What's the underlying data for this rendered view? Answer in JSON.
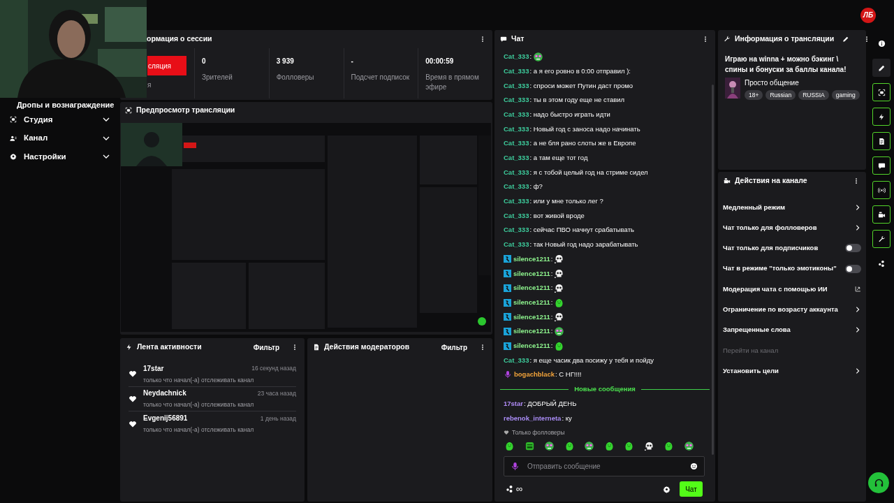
{
  "header": {
    "logo": "ЛБ"
  },
  "sidebar": {
    "partial_item": "Дропы и вознаграждение",
    "items": [
      {
        "label": "Студия",
        "expanded": false
      },
      {
        "label": "Канал",
        "expanded": false
      },
      {
        "label": "Настройки",
        "expanded": false
      }
    ]
  },
  "session": {
    "title": "ормация о сессии",
    "stream_button": "сляция",
    "stream_caption": "я",
    "stats": [
      {
        "value": "0",
        "label": "Зрителей"
      },
      {
        "value": "3 939",
        "label": "Фолловеры"
      },
      {
        "value": "-",
        "label": "Подсчет подписок"
      },
      {
        "value": "00:00:59",
        "label": "Время в прямом эфире"
      }
    ]
  },
  "preview": {
    "title": "Предпросмотр трансляции"
  },
  "activity": {
    "title": "Лента активности",
    "filter": "Фильтр",
    "items": [
      {
        "name": "17star",
        "time": "16 секунд назад",
        "text": "только что начал(-а) отслеживать канал"
      },
      {
        "name": "Neydachnick",
        "time": "23 часа назад",
        "text": "только что начал(-а) отслеживать канал"
      },
      {
        "name": "Evgenij56891",
        "time": "1 день назад",
        "text": "только что начал(-а) отслеживать канал"
      }
    ]
  },
  "moderators": {
    "title": "Действия модераторов",
    "filter": "Фильтр"
  },
  "chat": {
    "title": "Чат",
    "messages": [
      {
        "kind": "emote",
        "user": "Cat_333",
        "color": "#3ecf9e",
        "text": ":"
      },
      {
        "kind": "text",
        "user": "Cat_333",
        "color": "#3ecf9e",
        "text": ": а я его ровно в 0:00 отправил ):"
      },
      {
        "kind": "text",
        "user": "Cat_333",
        "color": "#3ecf9e",
        "text": ": спроси может Путин даст промо"
      },
      {
        "kind": "text",
        "user": "Cat_333",
        "color": "#3ecf9e",
        "text": ": ты в этом году еще не ставил"
      },
      {
        "kind": "text",
        "user": "Cat_333",
        "color": "#3ecf9e",
        "text": ": надо быстро играть идти"
      },
      {
        "kind": "text",
        "user": "Cat_333",
        "color": "#3ecf9e",
        "text": ": Новый год с заноса надо начинать"
      },
      {
        "kind": "text",
        "user": "Cat_333",
        "color": "#3ecf9e",
        "text": ": а не бля рано слоты же в Европе"
      },
      {
        "kind": "text",
        "user": "Cat_333",
        "color": "#3ecf9e",
        "text": ": а там еще тот год"
      },
      {
        "kind": "text",
        "user": "Cat_333",
        "color": "#3ecf9e",
        "text": ": я с тобой целый год на стриме сидел"
      },
      {
        "kind": "text",
        "user": "Cat_333",
        "color": "#3ecf9e",
        "text": ": ф?"
      },
      {
        "kind": "text",
        "user": "Cat_333",
        "color": "#3ecf9e",
        "text": ": или у мне только лег ?"
      },
      {
        "kind": "text",
        "user": "Cat_333",
        "color": "#3ecf9e",
        "text": ": вот живой вроде"
      },
      {
        "kind": "text",
        "user": "Cat_333",
        "color": "#3ecf9e",
        "text": ": сейчас ПВО начнут срабатывать"
      },
      {
        "kind": "text",
        "user": "Cat_333",
        "color": "#3ecf9e",
        "text": ": так Новый год надо зарабатывать"
      },
      {
        "kind": "moderator_emote",
        "user": "silence1211",
        "color": "#8ef58e",
        "text": ":"
      },
      {
        "kind": "moderator_emote",
        "user": "silence1211",
        "color": "#8ef58e",
        "text": ":"
      },
      {
        "kind": "moderator_emote",
        "user": "silence1211",
        "color": "#8ef58e",
        "text": ":"
      },
      {
        "kind": "moderator_emote",
        "user": "silence1211",
        "color": "#8ef58e",
        "text": ":"
      },
      {
        "kind": "moderator_emote",
        "user": "silence1211",
        "color": "#8ef58e",
        "text": ":"
      },
      {
        "kind": "moderator_emote",
        "user": "silence1211",
        "color": "#8ef58e",
        "text": ":"
      },
      {
        "kind": "moderator_emote",
        "user": "silence1211",
        "color": "#8ef58e",
        "text": ":"
      },
      {
        "kind": "text",
        "user": "Cat_333",
        "color": "#3ecf9e",
        "text": ": я еще часик два посижу у тебя и пойду"
      },
      {
        "kind": "voice_text",
        "user": "bogachblack",
        "color": "#f2a33a",
        "text": ": С НГ!!!!"
      }
    ],
    "divider": "Новые сообщения",
    "new_messages": [
      {
        "user": "17star",
        "color": "#b18cf7",
        "text": ": ДОБРЫЙ ДЕНЬ"
      },
      {
        "user": "rebenok_interneta",
        "color": "#a98cf5",
        "text": ": ку"
      }
    ],
    "mode_note": "Только фолловеры",
    "input": {
      "placeholder": "Отправить сообщение"
    },
    "points": "∞",
    "send_button": "Чат"
  },
  "stream_info": {
    "title": "Информация о трансляции",
    "stream_title": "Играю на winna + можно бэкинг \\ спины и бонуски за баллы канала!",
    "category": "Просто общение",
    "tags": [
      "18+",
      "Russian",
      "RUSSIA",
      "gaming"
    ]
  },
  "channel_actions": {
    "title": "Действия на канале",
    "items": [
      {
        "label": "Медленный режим",
        "kind": "chevron"
      },
      {
        "label": "Чат только для фолловеров",
        "kind": "chevron"
      },
      {
        "label": "Чат только для подписчиков",
        "kind": "toggle",
        "on": false
      },
      {
        "label": "Чат в режиме \"только эмотиконы\"",
        "kind": "toggle",
        "on": false
      },
      {
        "label": "Модерация чата с помощью ИИ",
        "kind": "external"
      },
      {
        "label": "Ограничение по возрасту аккаунта",
        "kind": "chevron"
      },
      {
        "label": "Запрещенные слова",
        "kind": "chevron"
      },
      {
        "label": "Перейти на канал",
        "kind": "disabled"
      },
      {
        "label": "Установить цели",
        "kind": "chevron"
      }
    ]
  }
}
